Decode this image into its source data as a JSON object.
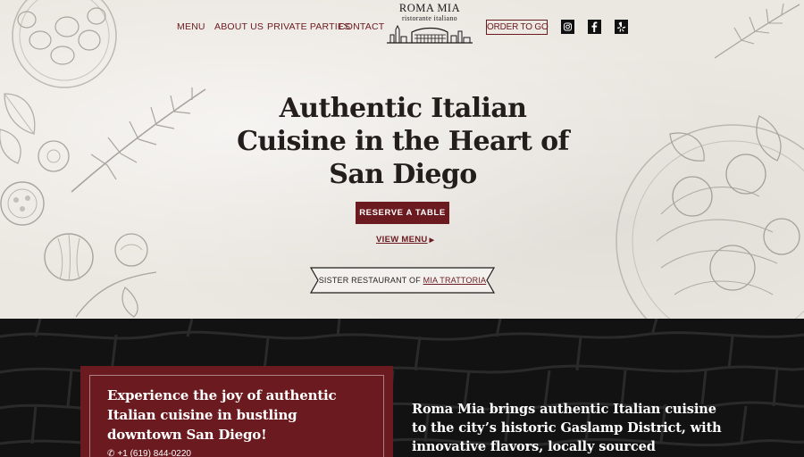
{
  "nav": {
    "menu": "MENU",
    "about": "ABOUT US",
    "parties": "PRIVATE PARTIES",
    "contact": "CONTACT",
    "order": "ORDER TO GO"
  },
  "logo": {
    "title": "ROMA MIA",
    "subtitle": "ristorante italiano"
  },
  "social": [
    "instagram-icon",
    "facebook-icon",
    "yelp-icon"
  ],
  "hero": {
    "headline": "Authentic Italian Cuisine in the Heart of San Diego",
    "reserve": "RESERVE A TABLE",
    "view_menu": "VIEW MENU",
    "sister_prefix": "SISTER RESTAURANT OF",
    "sister_link": "MIA TRATTORIA"
  },
  "card": {
    "title": "Experience the joy of authentic Italian cuisine in bustling downtown San Diego!",
    "phone": "+1 (619) 844-0220"
  },
  "about": {
    "text": "Roma Mia brings authentic Italian cuisine to the city’s historic Gaslamp District, with innovative flavors, locally sourced ingredients,"
  },
  "colors": {
    "accent": "#6b1a1f",
    "hero_bg": "#ebe7e1",
    "dark_bg": "#121212",
    "text_dark": "#231d1c"
  }
}
